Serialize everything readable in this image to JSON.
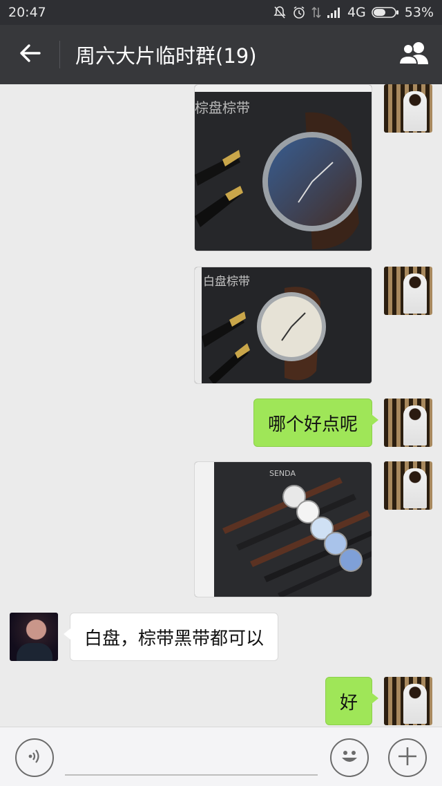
{
  "status_bar": {
    "time": "20:47",
    "network": "4G",
    "battery": "53%",
    "icons": [
      "mute-icon",
      "alarm-icon",
      "data-icon",
      "signal-icon",
      "battery-icon"
    ]
  },
  "header": {
    "title": "周六大片临时群(19)",
    "back_icon": "back-arrow-icon",
    "group_icon": "group-members-icon"
  },
  "messages": [
    {
      "type": "image",
      "direction": "out",
      "image_text": "棕盘棕带"
    },
    {
      "type": "image",
      "direction": "out",
      "image_text": "白盘棕带"
    },
    {
      "type": "text",
      "direction": "out",
      "text": "哪个好点呢"
    },
    {
      "type": "image",
      "direction": "out",
      "image_text": "SENDA"
    },
    {
      "type": "text",
      "direction": "in",
      "text": "白盘，棕带黑带都可以"
    },
    {
      "type": "text",
      "direction": "out",
      "text": "好"
    }
  ],
  "input_bar": {
    "voice_icon": "voice-icon",
    "placeholder": "",
    "emoji_icon": "emoji-icon",
    "plus_icon": "plus-icon"
  },
  "colors": {
    "status_bar": "#2e2f33",
    "title_bar": "#37383b",
    "chat_bg": "#ebebeb",
    "outgoing_bubble": "#9fe658",
    "incoming_bubble": "#ffffff"
  }
}
